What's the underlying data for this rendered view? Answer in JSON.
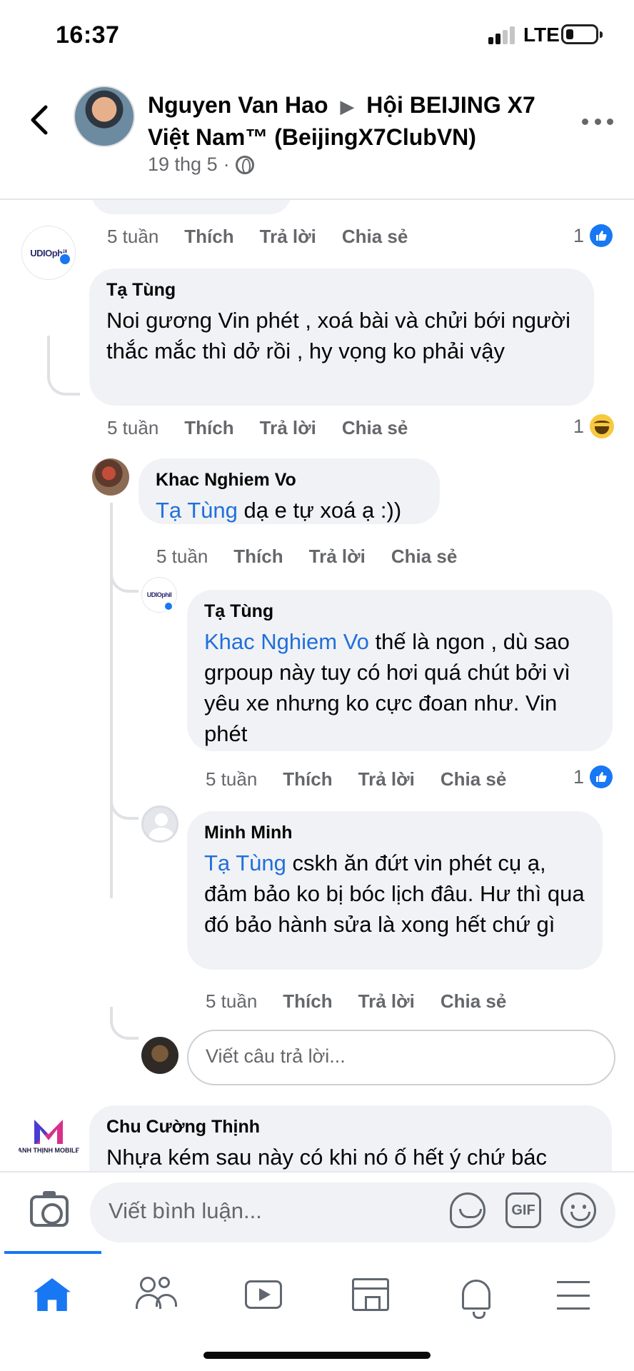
{
  "status_bar": {
    "time": "16:37",
    "network": "LTE"
  },
  "post_header": {
    "author": "Nguyen Van Hao",
    "arrow": "▶",
    "group": "Hội BEIJING X7 Việt Nam™ (BeijingX7ClubVN)",
    "date": "19 thg 5",
    "separator": "·"
  },
  "actions_labels": {
    "like": "Thích",
    "reply": "Trả lời",
    "share": "Chia sẻ"
  },
  "comments": [
    {
      "id": "c0",
      "age": "5 tuần",
      "reaction_count": "1",
      "reaction": "like"
    },
    {
      "id": "c1",
      "author": "Tạ Tùng",
      "avatar_text": "UDIOphil",
      "text": "Noi gương Vin phét , xoá bài và chửi bới người thắc mắc thì dở rồi , hy vọng ko phải vậy",
      "age": "5 tuần",
      "reaction_count": "1",
      "reaction": "haha"
    },
    {
      "id": "c2",
      "author": "Khac Nghiem Vo",
      "mention": "Tạ Tùng",
      "text": " dạ e tự xoá ạ :))",
      "age": "5 tuần"
    },
    {
      "id": "c3",
      "author": "Tạ Tùng",
      "avatar_text": "UDIOphil",
      "mention": "Khac Nghiem Vo",
      "text": "  thế là ngon , dù sao grpoup này tuy có hơi quá chút bởi vì yêu xe nhưng ko cực đoan như. Vin phét",
      "age": "5 tuần",
      "reaction_count": "1",
      "reaction": "like"
    },
    {
      "id": "c4",
      "author": "Minh Minh",
      "mention": "Tạ Tùng",
      "text": " cskh ăn đứt vin phét cụ ạ, đảm bảo ko bị bóc lịch đâu. Hư thì qua đó bảo hành sửa là xong hết chứ gì",
      "age": "5 tuần"
    },
    {
      "id": "c5",
      "author": "Chu Cường Thịnh",
      "avatar_text": "ANH THỊNH MOBILE",
      "text": "Nhựa kém sau này có khi nó ố hết ý chứ bác"
    }
  ],
  "reply_placeholder": "Viết câu trả lời...",
  "composer": {
    "placeholder": "Viết bình luận...",
    "gif_label": "GIF"
  },
  "icons": {
    "back": "chevron-left-icon",
    "more": "more-icon",
    "globe": "globe-icon",
    "camera": "camera-icon",
    "sticker": "sticker-icon",
    "gif": "gif-icon",
    "emoji": "emoji-icon",
    "tabs": [
      "home-icon",
      "friends-icon",
      "watch-icon",
      "marketplace-icon",
      "notifications-icon",
      "menu-icon"
    ]
  },
  "colors": {
    "accent": "#1877f2",
    "mention": "#216fdb",
    "bubble": "#f0f2f5",
    "secondary_text": "#65676b"
  }
}
